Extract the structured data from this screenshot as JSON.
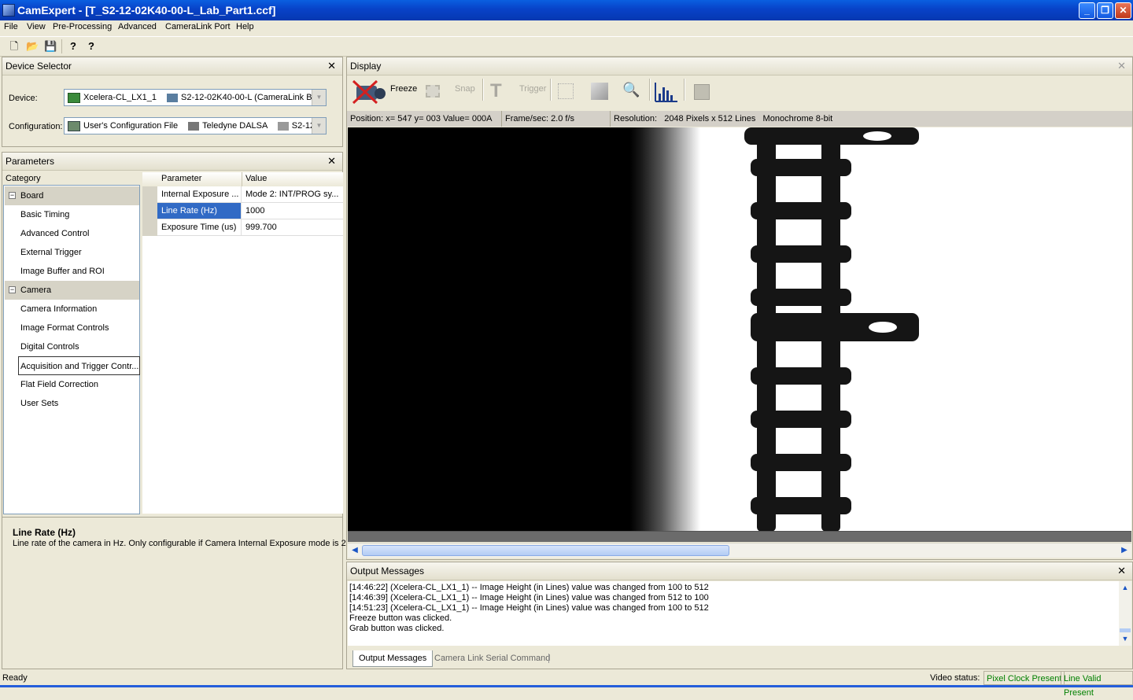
{
  "window": {
    "title": "CamExpert - [T_S2-12-02K40-00-L_Lab_Part1.ccf]",
    "min": "_",
    "max": "❐",
    "close": "✕"
  },
  "menu": [
    "File",
    "View",
    "Pre-Processing",
    "Advanced",
    "CameraLink Port",
    "Help"
  ],
  "toolbar": {
    "icons": [
      "new-icon",
      "open-icon",
      "save-icon",
      "help-icon",
      "context-help-icon"
    ],
    "glyphs": [
      "🗋",
      "📂",
      "💾",
      "?",
      "?"
    ]
  },
  "device_selector": {
    "title": "Device Selector",
    "device_label": "Device:",
    "device_board": "Xcelera-CL_LX1_1",
    "device_camera": "S2-12-02K40-00-L (CameraLink Ba",
    "config_label": "Configuration:",
    "config_file": "User's Configuration File",
    "config_vendor": "Teledyne DALSA",
    "config_model": "S2-12"
  },
  "parameters": {
    "title": "Parameters",
    "category_header": "Category",
    "param_header": "Parameter",
    "value_header": "Value",
    "categories": [
      {
        "label": "Board",
        "group": true,
        "expander": "−"
      },
      {
        "label": "Basic Timing"
      },
      {
        "label": "Advanced Control"
      },
      {
        "label": "External Trigger"
      },
      {
        "label": "Image Buffer and ROI"
      },
      {
        "label": "Camera",
        "group": true,
        "expander": "−"
      },
      {
        "label": "Camera Information"
      },
      {
        "label": "Image Format Controls"
      },
      {
        "label": "Digital Controls"
      },
      {
        "label": "Acquisition and Trigger Contr..."
      },
      {
        "label": "Flat Field Correction"
      },
      {
        "label": "User Sets"
      }
    ],
    "rows": [
      {
        "param": "Internal Exposure ...",
        "value": "Mode 2: INT/PROG sy..."
      },
      {
        "param": "Line Rate (Hz)",
        "value": "1000"
      },
      {
        "param": "Exposure Time (us)",
        "value": "999.700"
      }
    ],
    "help_title": "Line Rate (Hz)",
    "help_text": "Line rate of the camera in Hz. Only configurable if Camera Internal Exposure mode is 2"
  },
  "display": {
    "title": "Display",
    "freeze": "Freeze",
    "snap": "Snap",
    "trigger": "Trigger",
    "position": "Position:   x= 547 y= 003 Value= 000A",
    "framerate": "Frame/sec:  2.0 f/s",
    "resolution": "Resolution:   2048 Pixels x 512 Lines   Monochrome 8-bit"
  },
  "output": {
    "title": "Output Messages",
    "lines": [
      "[14:46:22] (Xcelera-CL_LX1_1)  -- Image Height (in Lines) value was changed from 100 to 512",
      "[14:46:39] (Xcelera-CL_LX1_1)  -- Image Height (in Lines) value was changed from 512 to 100",
      "[14:51:23] (Xcelera-CL_LX1_1)  -- Image Height (in Lines) value was changed from 100 to 512",
      "Freeze button was clicked.",
      "Grab button was clicked."
    ],
    "tabs": [
      "Output Messages",
      "Camera Link Serial Command"
    ]
  },
  "statusbar": {
    "ready": "Ready",
    "video_status": "Video status:",
    "pixel_clock": "Pixel Clock Present",
    "line_valid": "Line Valid Present"
  },
  "colors": {
    "accent": "#316AC5",
    "status_ok": "#008000"
  }
}
